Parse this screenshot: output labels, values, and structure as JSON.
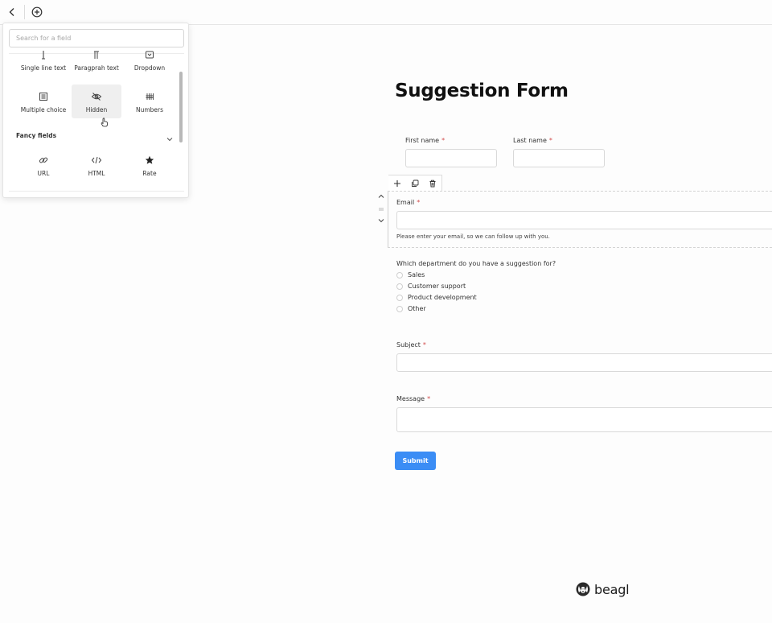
{
  "topbar": {
    "back_icon": "chevron-left-icon",
    "add_icon": "plus-circle-icon"
  },
  "picker": {
    "search_placeholder": "Search for a field",
    "basic_fields": [
      {
        "label": "Single line text",
        "icon": "text-cursor-icon"
      },
      {
        "label": "Paragprah text",
        "icon": "paragraph-icon"
      },
      {
        "label": "Dropdown",
        "icon": "dropdown-icon"
      },
      {
        "label": "Multiple choice",
        "icon": "list-icon"
      },
      {
        "label": "Hidden",
        "icon": "eye-off-icon"
      },
      {
        "label": "Numbers",
        "icon": "hash-icon"
      }
    ],
    "fancy_title": "Fancy fields",
    "fancy_fields": [
      {
        "label": "URL",
        "icon": "link-icon"
      },
      {
        "label": "HTML",
        "icon": "code-icon"
      },
      {
        "label": "Rate",
        "icon": "star-icon"
      }
    ]
  },
  "form": {
    "title": "Suggestion Form",
    "first_name_label": "First name",
    "last_name_label": "Last name",
    "email_label": "Email",
    "email_hint": "Please enter your email, so we can follow up with you.",
    "department_question": "Which department do you have a suggestion for?",
    "department_options": [
      "Sales",
      "Customer support",
      "Product development",
      "Other"
    ],
    "subject_label": "Subject",
    "message_label": "Message",
    "required_mark": "*",
    "submit_label": "Submit"
  },
  "brand": {
    "name": "beagl"
  },
  "colors": {
    "accent": "#3b8df5",
    "required": "#d24b4b"
  }
}
